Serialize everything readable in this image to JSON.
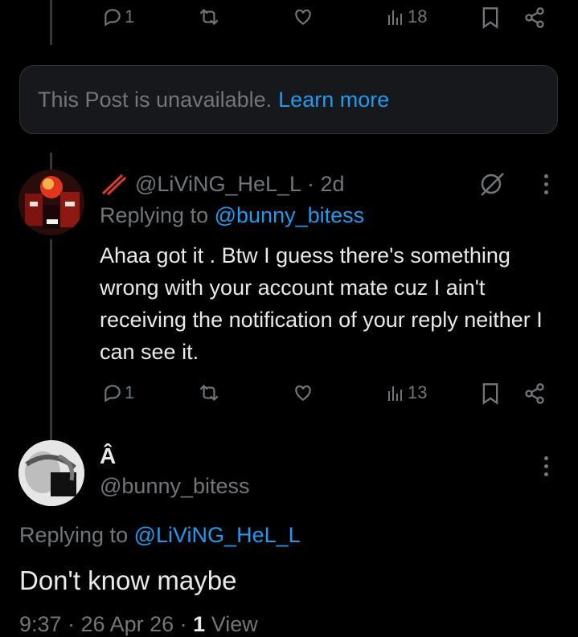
{
  "top_post": {
    "replies": "1",
    "views": "18"
  },
  "unavailable": {
    "text": "This Post is unavailable.",
    "link": "Learn more"
  },
  "reply_post": {
    "handle": "@LiViNG_HeL_L",
    "time": "· 2d",
    "replying_label": "Replying to",
    "replying_handle": "@bunny_bitess",
    "body": "Ahaa got it . Btw I guess there's something wrong with your account mate cuz I ain't receiving the notification of your reply neither I can see it.",
    "replies": "1",
    "views": "13"
  },
  "main_post": {
    "display_name": "Â",
    "handle": "@bunny_bitess",
    "replying_label": "Replying to",
    "replying_handle": "@LiViNG_HeL_L",
    "body": "Don't know maybe",
    "footer_time": "9:37 · 26 Apr 26 ·",
    "footer_views_count": "1",
    "footer_views_label": "View"
  },
  "colors": {
    "background": "#000000",
    "text": "#e7e9ea",
    "muted": "#71767b",
    "link": "#1d9bf0"
  }
}
